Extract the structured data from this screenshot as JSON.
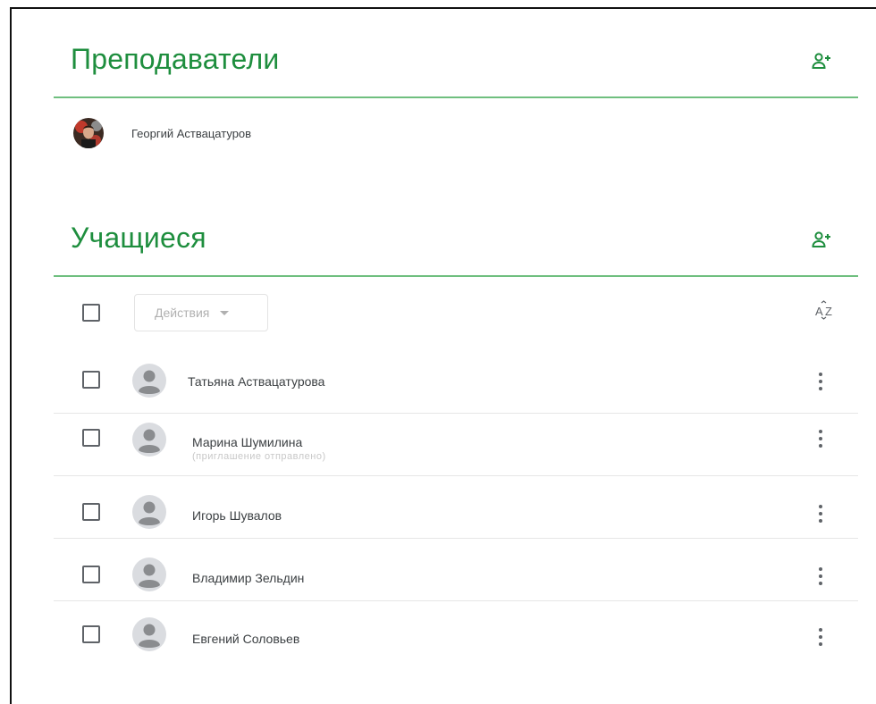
{
  "teachers": {
    "title": "Преподаватели",
    "add_icon": "person-add-icon",
    "list": [
      {
        "name": "Георгий Аствацатуров",
        "avatar": "photo-avatar"
      }
    ]
  },
  "students": {
    "title": "Учащиеся",
    "add_icon": "person-add-icon",
    "toolbar": {
      "actions_label": "Действия",
      "sort_icon": "sort-az-icon"
    },
    "list": [
      {
        "name": "Татьяна Аствацатурова"
      },
      {
        "name": "Марина Шумилина",
        "subtext": "(приглашение отправлено)"
      },
      {
        "name": "Игорь Шувалов"
      },
      {
        "name": "Владимир Зельдин"
      },
      {
        "name": "Евгений Соловьев"
      }
    ]
  },
  "colors": {
    "accent": "#1e8e3e",
    "divider": "#6fbf7f",
    "icon": "#5f6368"
  }
}
